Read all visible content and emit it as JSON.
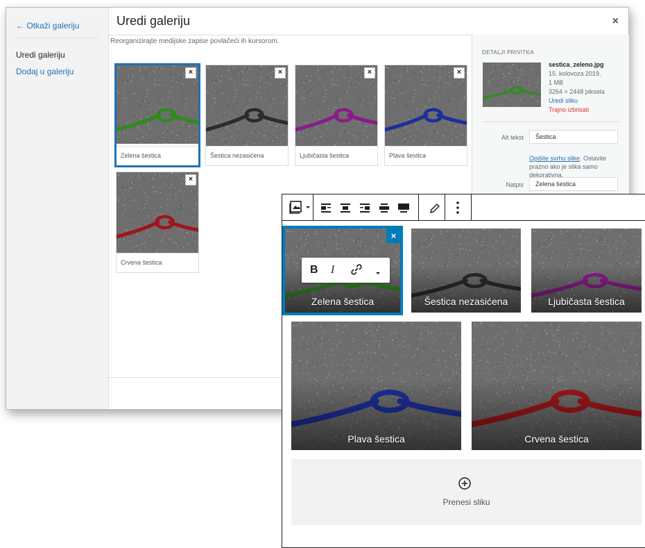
{
  "modal": {
    "cancel_link": "← Otkaži galeriju",
    "menu": [
      "Uredi galeriju",
      "Dodaj u galeriju"
    ],
    "title": "Uredi galeriju",
    "close": "×",
    "instructions": "Reorganizirajte medijske zapise povlačeći ih kursorom.",
    "attachments": [
      {
        "caption": "Zelena šestica",
        "color": "#2e8b1e"
      },
      {
        "caption": "Šestica nezasićena",
        "color": "#2b2b2b"
      },
      {
        "caption": "Ljubičasta šestica",
        "color": "#8a1c8a"
      },
      {
        "caption": "Plava šestica",
        "color": "#1d2f9a"
      },
      {
        "caption": "Crvena šestica",
        "color": "#a0161b"
      }
    ],
    "remove": "×",
    "details": {
      "heading": "DETALJI PRIVITKA",
      "filename": "sestica_zeleno.jpg",
      "date": "15. kolovoza 2019.",
      "size": "1 MB",
      "dimensions": "3264 × 2448 piksela",
      "edit_link": "Uredi sliku",
      "delete_link": "Trajno izbrisati",
      "alt_label": "Alt tekst",
      "alt_value": "Šestica",
      "alt_help_link": "Opišite svrhu slike",
      "alt_help_rest": ". Ostavite prazno ako je slika samo dekorativna.",
      "caption_label": "Natpis",
      "caption_value": "Zelena šestica"
    }
  },
  "editor": {
    "toolbar_icons": [
      "gallery-icon",
      "dropdown-icon",
      "align-left-icon",
      "align-center-icon",
      "align-right-icon",
      "wide-width-icon",
      "full-width-icon",
      "edit-pencil-icon",
      "more-options-icon"
    ],
    "gallery": [
      {
        "caption": "Zelena šestica",
        "color": "#2e8b1e"
      },
      {
        "caption": "Šestica nezasićena",
        "color": "#2b2b2b"
      },
      {
        "caption": "Ljubičasta šestica",
        "color": "#8a1c8a"
      },
      {
        "caption": "Plava šestica",
        "color": "#1d2f9a"
      },
      {
        "caption": "Crvena šestica",
        "color": "#a0161b"
      }
    ],
    "remove": "×",
    "inline_toolbar": {
      "bold": "B",
      "italic": "I"
    },
    "upload_label": "Prenesi sliku",
    "accent": "#007cba"
  }
}
